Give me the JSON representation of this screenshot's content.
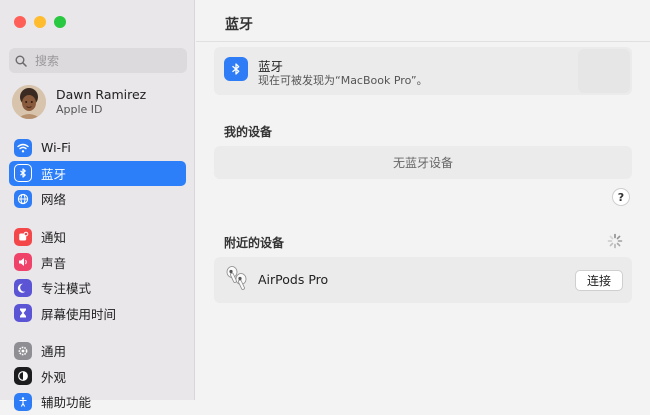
{
  "window": {
    "title": "蓝牙"
  },
  "search": {
    "placeholder": "搜索"
  },
  "account": {
    "name": "Dawn Ramirez",
    "subtitle": "Apple ID"
  },
  "sidebar": {
    "items": [
      {
        "label": "Wi-Fi",
        "icon": "wifi-icon",
        "color": "#2f7df6"
      },
      {
        "label": "蓝牙",
        "icon": "bluetooth-icon",
        "color": "#2f7df6",
        "selected": true
      },
      {
        "label": "网络",
        "icon": "globe-icon",
        "color": "#2f7df6"
      },
      {
        "label": "通知",
        "icon": "bell-icon",
        "color": "#f4474a"
      },
      {
        "label": "声音",
        "icon": "speaker-icon",
        "color": "#f0436a"
      },
      {
        "label": "专注模式",
        "icon": "moon-icon",
        "color": "#5b55d6"
      },
      {
        "label": "屏幕使用时间",
        "icon": "hourglass-icon",
        "color": "#5b55d6"
      },
      {
        "label": "通用",
        "icon": "gear-icon",
        "color": "#8e8e93"
      },
      {
        "label": "外观",
        "icon": "appearance-icon",
        "color": "#1c1c1e"
      },
      {
        "label": "辅助功能",
        "icon": "accessibility-icon",
        "color": "#2f7df6"
      }
    ]
  },
  "bluetooth": {
    "title": "蓝牙",
    "status": "现在可被发现为“MacBook Pro”。"
  },
  "my_devices": {
    "title": "我的设备",
    "empty_text": "无蓝牙设备"
  },
  "help": {
    "label": "?"
  },
  "nearby": {
    "title": "附近的设备",
    "devices": [
      {
        "name": "AirPods Pro",
        "action": "连接"
      }
    ]
  },
  "colors": {
    "accent": "#2d7ff9",
    "bluetooth": "#2f7df6"
  }
}
